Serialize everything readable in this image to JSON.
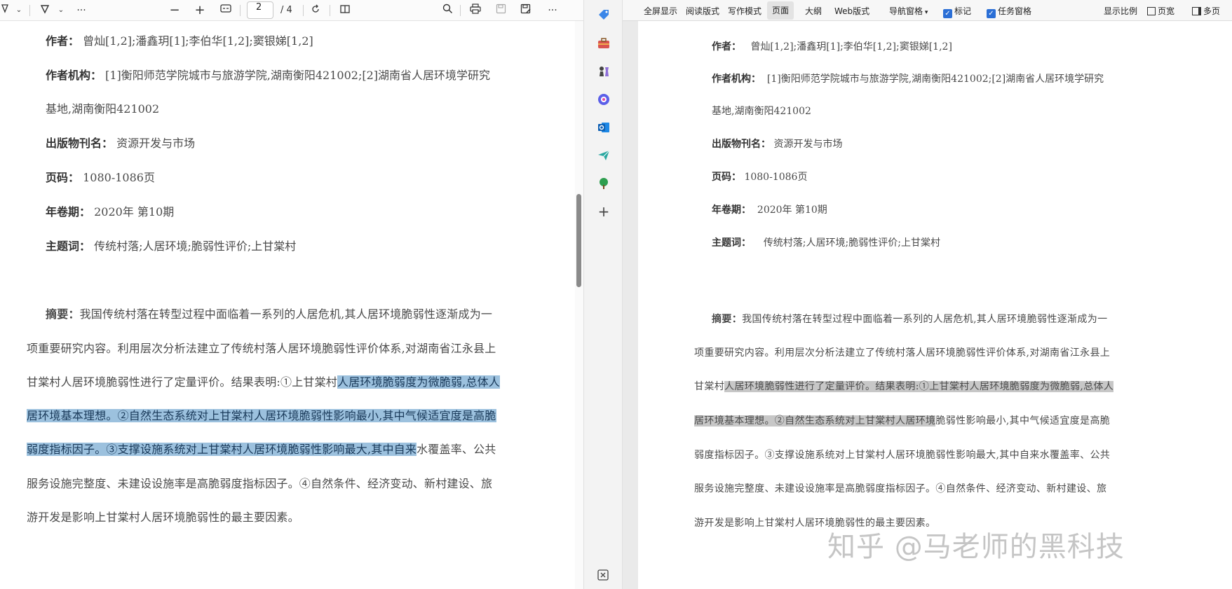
{
  "pdf_viewer": {
    "toolbar": {
      "page_number": "2",
      "page_total": "/ 4",
      "zoom_out": "−",
      "zoom_in": "+",
      "more": "···"
    },
    "meta": {
      "authors_label": "作者：",
      "authors_value": "曾灿[1,2];潘鑫玥[1];李伯华[1,2];窦银娣[1,2]",
      "institution_label": "作者机构：",
      "institution_value_1": "[1]衡阳师范学院城市与旅游学院,湖南衡阳421002;[2]湖南省人居环境学研究",
      "institution_value_2": "基地,湖南衡阳421002",
      "publication_label": "出版物刊名：",
      "publication_value": "资源开发与市场",
      "pages_label": "页码：",
      "pages_value": "1080-1086页",
      "year_issue_label": "年卷期：",
      "year_issue_value": "2020年 第10期",
      "keywords_label": "主题词：",
      "keywords_value": "传统村落;人居环境;脆弱性评价;上甘棠村"
    },
    "abstract": {
      "label": "摘要：",
      "l1": "我国传统村落在转型过程中面临着一系列的人居危机,其人居环境脆弱性逐渐成为一",
      "l2": "项重要研究内容。利用层次分析法建立了传统村落人居环境脆弱性评价体系,对湖南省江永县上",
      "l3a": "甘棠村人居环境脆弱性进行了定量评价。结果表明:①上甘棠村",
      "l3b": "人居环境脆弱度为微脆弱,总体人",
      "l4": "居环境基本理想。②自然生态系统对上甘棠村人居环境脆弱性影响最小,其中气候适宜度是高脆",
      "l5a": "弱度指标因子。③支撑设施系统对上甘棠村人居环境脆弱性影响最大,其中自来",
      "l5b": "水覆盖率、公共",
      "l6": "服务设施完整度、未建设设施率是高脆弱度指标因子。④自然条件、经济变动、新村建设、旅",
      "l7": "游开发是影响上甘棠村人居环境脆弱性的最主要因素。"
    }
  },
  "word_app": {
    "toolbar": {
      "fullscreen": "全屏显示",
      "read_mode": "阅读版式",
      "write_mode": "写作模式",
      "page": "页面",
      "outline": "大纲",
      "web_mode": "Web版式",
      "nav_pane": "导航窗格",
      "marks": "标记",
      "task_pane": "任务窗格",
      "zoom": "显示比例",
      "page_width": "页宽",
      "multi_page": "多页"
    },
    "meta": {
      "authors_label": "作者：",
      "authors_value": "曾灿[1,2];潘鑫玥[1];李伯华[1,2];窦银娣[1,2]",
      "institution_label": "作者机构：",
      "institution_value_1": "[1]衡阳师范学院城市与旅游学院,湖南衡阳421002;[2]湖南省人居环境学研究",
      "institution_value_2": "基地,湖南衡阳421002",
      "publication_label": "出版物刊名：",
      "publication_value": "资源开发与市场",
      "pages_label": "页码：",
      "pages_value": "1080-1086页",
      "year_issue_label": "年卷期：",
      "year_issue_value": "2020年 第10期",
      "keywords_label": "主题词：",
      "keywords_value": "传统村落;人居环境;脆弱性评价;上甘棠村"
    },
    "abstract": {
      "label": "摘要：",
      "l1": "我国传统村落在转型过程中面临着一系列的人居危机,其人居环境脆弱性逐渐成为一",
      "l2": "项重要研究内容。利用层次分析法建立了传统村落人居环境脆弱性评价体系,对湖南省江永县上",
      "l3a": "甘棠村",
      "l3b": "人居环境脆弱性进行了定量评价。结果表明:①上甘棠村人居环境脆弱度为微脆弱,总体人",
      "l4a": "居环境基本理想。②自然生态系统对上甘棠村人居环境",
      "l4b": "脆弱性影响最小,其中气候适宜度是高脆",
      "l5": "弱度指标因子。③支撑设施系统对上甘棠村人居环境脆弱性影响最大,其中自来水覆盖率、公共",
      "l6": "服务设施完整度、未建设设施率是高脆弱度指标因子。④自然条件、经济变动、新村建设、旅",
      "l7": "游开发是影响上甘棠村人居环境脆弱性的最主要因素。"
    }
  },
  "watermark": "知乎 @马老师的黑科技",
  "colors": {
    "pdf_highlight": "#9cc1de",
    "word_highlight": "#c7c7c7",
    "checkbox": "#2b6fd6"
  }
}
